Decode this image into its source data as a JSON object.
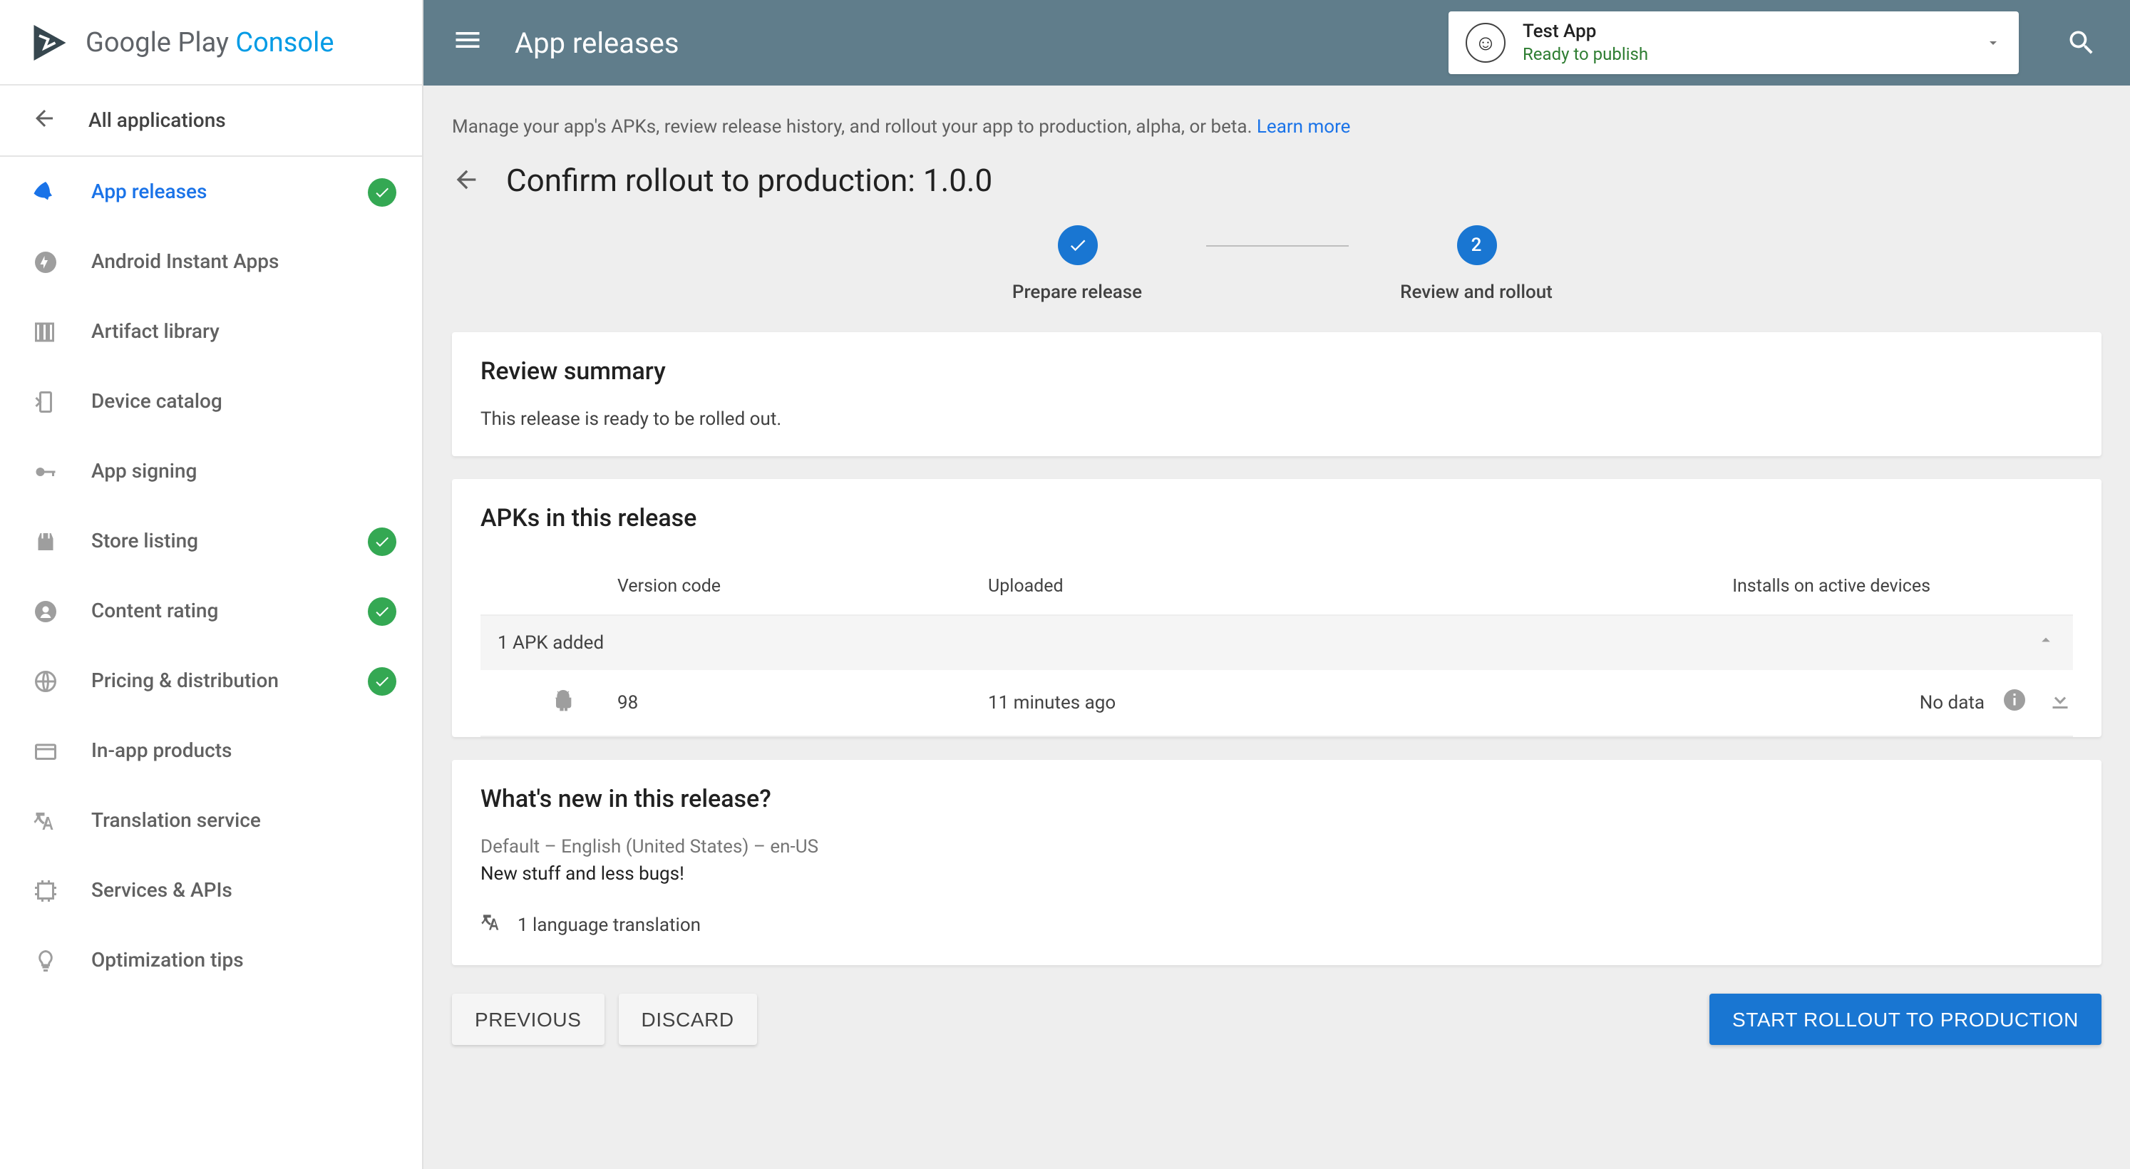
{
  "logo": {
    "brand": "Google Play",
    "product": "Console"
  },
  "nav": {
    "all_apps": "All applications",
    "items": [
      {
        "label": "App releases",
        "check": true,
        "active": true,
        "icon": "rocket"
      },
      {
        "label": "Android Instant Apps",
        "check": false,
        "icon": "bolt"
      },
      {
        "label": "Artifact library",
        "check": false,
        "icon": "library"
      },
      {
        "label": "Device catalog",
        "check": false,
        "icon": "device"
      },
      {
        "label": "App signing",
        "check": false,
        "icon": "key"
      },
      {
        "label": "Store listing",
        "check": true,
        "icon": "store"
      },
      {
        "label": "Content rating",
        "check": true,
        "icon": "rating"
      },
      {
        "label": "Pricing & distribution",
        "check": true,
        "icon": "globe"
      },
      {
        "label": "In-app products",
        "check": false,
        "icon": "card"
      },
      {
        "label": "Translation service",
        "check": false,
        "icon": "translate"
      },
      {
        "label": "Services & APIs",
        "check": false,
        "icon": "services"
      },
      {
        "label": "Optimization tips",
        "check": false,
        "icon": "bulb"
      }
    ]
  },
  "header": {
    "title": "App releases",
    "app_name": "Test App",
    "app_status": "Ready to publish"
  },
  "intro": {
    "text": "Manage your app's APKs, review release history, and rollout your app to production, alpha, or beta. ",
    "link": "Learn more"
  },
  "page_title": "Confirm rollout to production: 1.0.0",
  "stepper": {
    "step1": "Prepare release",
    "step2_num": "2",
    "step2": "Review and rollout"
  },
  "review": {
    "title": "Review summary",
    "body": "This release is ready to be rolled out."
  },
  "apks": {
    "title": "APKs in this release",
    "col_version": "Version code",
    "col_uploaded": "Uploaded",
    "col_installs": "Installs on active devices",
    "group": "1 APK added",
    "rows": [
      {
        "version": "98",
        "uploaded": "11 minutes ago",
        "installs": "No data"
      }
    ]
  },
  "whatsnew": {
    "title": "What's new in this release?",
    "lang": "Default – English (United States) – en-US",
    "notes": "New stuff and less bugs!",
    "translations": "1 language translation"
  },
  "buttons": {
    "previous": "PREVIOUS",
    "discard": "DISCARD",
    "start": "START ROLLOUT TO PRODUCTION"
  }
}
